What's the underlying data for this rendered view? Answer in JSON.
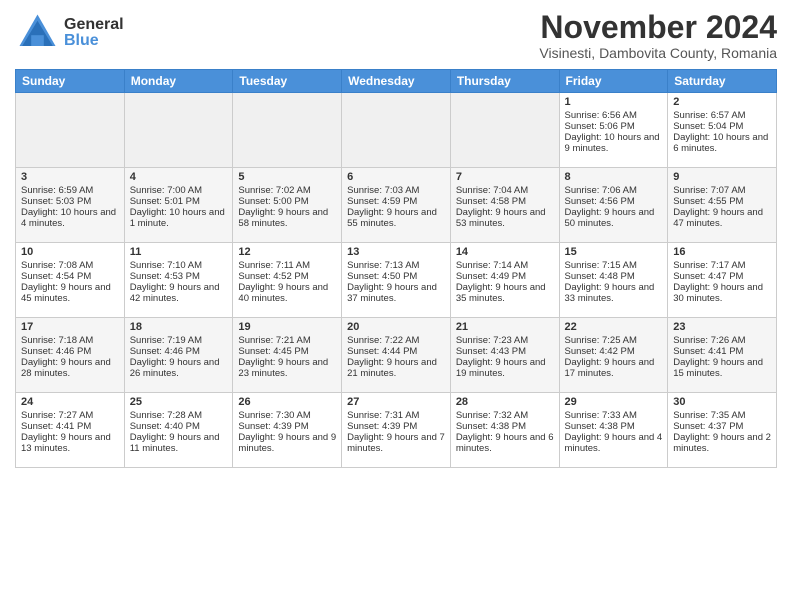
{
  "header": {
    "month_title": "November 2024",
    "subtitle": "Visinesti, Dambovita County, Romania",
    "logo_general": "General",
    "logo_blue": "Blue"
  },
  "days_of_week": [
    "Sunday",
    "Monday",
    "Tuesday",
    "Wednesday",
    "Thursday",
    "Friday",
    "Saturday"
  ],
  "weeks": [
    [
      {
        "day": "",
        "empty": true
      },
      {
        "day": "",
        "empty": true
      },
      {
        "day": "",
        "empty": true
      },
      {
        "day": "",
        "empty": true
      },
      {
        "day": "",
        "empty": true
      },
      {
        "day": "1",
        "sunrise": "Sunrise: 6:56 AM",
        "sunset": "Sunset: 5:06 PM",
        "daylight": "Daylight: 10 hours and 9 minutes."
      },
      {
        "day": "2",
        "sunrise": "Sunrise: 6:57 AM",
        "sunset": "Sunset: 5:04 PM",
        "daylight": "Daylight: 10 hours and 6 minutes."
      }
    ],
    [
      {
        "day": "3",
        "sunrise": "Sunrise: 6:59 AM",
        "sunset": "Sunset: 5:03 PM",
        "daylight": "Daylight: 10 hours and 4 minutes."
      },
      {
        "day": "4",
        "sunrise": "Sunrise: 7:00 AM",
        "sunset": "Sunset: 5:01 PM",
        "daylight": "Daylight: 10 hours and 1 minute."
      },
      {
        "day": "5",
        "sunrise": "Sunrise: 7:02 AM",
        "sunset": "Sunset: 5:00 PM",
        "daylight": "Daylight: 9 hours and 58 minutes."
      },
      {
        "day": "6",
        "sunrise": "Sunrise: 7:03 AM",
        "sunset": "Sunset: 4:59 PM",
        "daylight": "Daylight: 9 hours and 55 minutes."
      },
      {
        "day": "7",
        "sunrise": "Sunrise: 7:04 AM",
        "sunset": "Sunset: 4:58 PM",
        "daylight": "Daylight: 9 hours and 53 minutes."
      },
      {
        "day": "8",
        "sunrise": "Sunrise: 7:06 AM",
        "sunset": "Sunset: 4:56 PM",
        "daylight": "Daylight: 9 hours and 50 minutes."
      },
      {
        "day": "9",
        "sunrise": "Sunrise: 7:07 AM",
        "sunset": "Sunset: 4:55 PM",
        "daylight": "Daylight: 9 hours and 47 minutes."
      }
    ],
    [
      {
        "day": "10",
        "sunrise": "Sunrise: 7:08 AM",
        "sunset": "Sunset: 4:54 PM",
        "daylight": "Daylight: 9 hours and 45 minutes."
      },
      {
        "day": "11",
        "sunrise": "Sunrise: 7:10 AM",
        "sunset": "Sunset: 4:53 PM",
        "daylight": "Daylight: 9 hours and 42 minutes."
      },
      {
        "day": "12",
        "sunrise": "Sunrise: 7:11 AM",
        "sunset": "Sunset: 4:52 PM",
        "daylight": "Daylight: 9 hours and 40 minutes."
      },
      {
        "day": "13",
        "sunrise": "Sunrise: 7:13 AM",
        "sunset": "Sunset: 4:50 PM",
        "daylight": "Daylight: 9 hours and 37 minutes."
      },
      {
        "day": "14",
        "sunrise": "Sunrise: 7:14 AM",
        "sunset": "Sunset: 4:49 PM",
        "daylight": "Daylight: 9 hours and 35 minutes."
      },
      {
        "day": "15",
        "sunrise": "Sunrise: 7:15 AM",
        "sunset": "Sunset: 4:48 PM",
        "daylight": "Daylight: 9 hours and 33 minutes."
      },
      {
        "day": "16",
        "sunrise": "Sunrise: 7:17 AM",
        "sunset": "Sunset: 4:47 PM",
        "daylight": "Daylight: 9 hours and 30 minutes."
      }
    ],
    [
      {
        "day": "17",
        "sunrise": "Sunrise: 7:18 AM",
        "sunset": "Sunset: 4:46 PM",
        "daylight": "Daylight: 9 hours and 28 minutes."
      },
      {
        "day": "18",
        "sunrise": "Sunrise: 7:19 AM",
        "sunset": "Sunset: 4:46 PM",
        "daylight": "Daylight: 9 hours and 26 minutes."
      },
      {
        "day": "19",
        "sunrise": "Sunrise: 7:21 AM",
        "sunset": "Sunset: 4:45 PM",
        "daylight": "Daylight: 9 hours and 23 minutes."
      },
      {
        "day": "20",
        "sunrise": "Sunrise: 7:22 AM",
        "sunset": "Sunset: 4:44 PM",
        "daylight": "Daylight: 9 hours and 21 minutes."
      },
      {
        "day": "21",
        "sunrise": "Sunrise: 7:23 AM",
        "sunset": "Sunset: 4:43 PM",
        "daylight": "Daylight: 9 hours and 19 minutes."
      },
      {
        "day": "22",
        "sunrise": "Sunrise: 7:25 AM",
        "sunset": "Sunset: 4:42 PM",
        "daylight": "Daylight: 9 hours and 17 minutes."
      },
      {
        "day": "23",
        "sunrise": "Sunrise: 7:26 AM",
        "sunset": "Sunset: 4:41 PM",
        "daylight": "Daylight: 9 hours and 15 minutes."
      }
    ],
    [
      {
        "day": "24",
        "sunrise": "Sunrise: 7:27 AM",
        "sunset": "Sunset: 4:41 PM",
        "daylight": "Daylight: 9 hours and 13 minutes."
      },
      {
        "day": "25",
        "sunrise": "Sunrise: 7:28 AM",
        "sunset": "Sunset: 4:40 PM",
        "daylight": "Daylight: 9 hours and 11 minutes."
      },
      {
        "day": "26",
        "sunrise": "Sunrise: 7:30 AM",
        "sunset": "Sunset: 4:39 PM",
        "daylight": "Daylight: 9 hours and 9 minutes."
      },
      {
        "day": "27",
        "sunrise": "Sunrise: 7:31 AM",
        "sunset": "Sunset: 4:39 PM",
        "daylight": "Daylight: 9 hours and 7 minutes."
      },
      {
        "day": "28",
        "sunrise": "Sunrise: 7:32 AM",
        "sunset": "Sunset: 4:38 PM",
        "daylight": "Daylight: 9 hours and 6 minutes."
      },
      {
        "day": "29",
        "sunrise": "Sunrise: 7:33 AM",
        "sunset": "Sunset: 4:38 PM",
        "daylight": "Daylight: 9 hours and 4 minutes."
      },
      {
        "day": "30",
        "sunrise": "Sunrise: 7:35 AM",
        "sunset": "Sunset: 4:37 PM",
        "daylight": "Daylight: 9 hours and 2 minutes."
      }
    ]
  ]
}
